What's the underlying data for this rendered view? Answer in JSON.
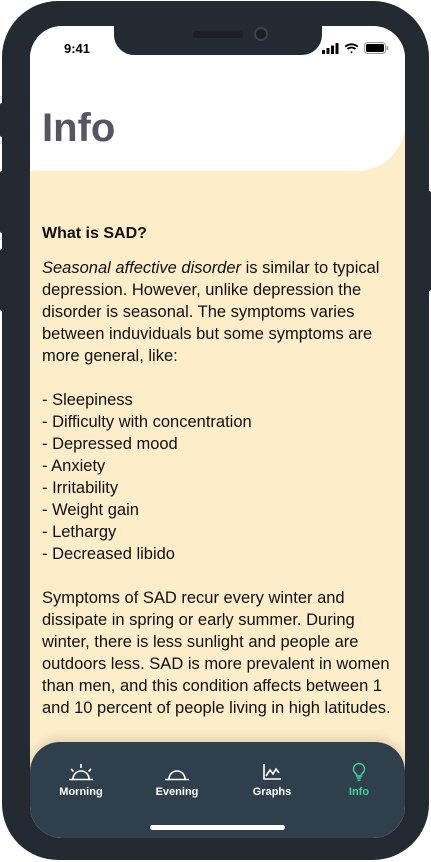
{
  "status_bar": {
    "time": "9:41",
    "icons": [
      "signal-icon",
      "wifi-icon",
      "battery-icon"
    ]
  },
  "page": {
    "title": "Info"
  },
  "article": {
    "heading": "What is SAD?",
    "intro_italic": "Seasonal affective disorder",
    "intro_rest": " is similar to typical depression. However, unlike depression the disorder is seasonal. The symptoms varies between induviduals but some symptoms are more general, like:",
    "symptoms": [
      "- Sleepiness",
      "- Difficulty with concentration",
      "- Depressed mood",
      "- Anxiety",
      "- Irritability",
      "- Weight gain",
      "- Lethargy",
      "- Decreased libido"
    ],
    "paragraph2": "Symptoms of SAD recur every winter and dissipate in spring or early summer. During winter, there is less sunlight and people are outdoors less. SAD is more prevalent in women than men, and this condition affects between 1 and 10 percent of people living in high latitudes."
  },
  "tabbar": {
    "tabs": [
      {
        "label": "Morning",
        "icon": "sunrise-icon",
        "active": false
      },
      {
        "label": "Evening",
        "icon": "sunset-icon",
        "active": false
      },
      {
        "label": "Graphs",
        "icon": "chart-icon",
        "active": false
      },
      {
        "label": "Info",
        "icon": "lightbulb-icon",
        "active": true
      }
    ]
  },
  "colors": {
    "background": "#fdedc9",
    "tabbar": "#2f3f4b",
    "active_tab": "#45d39a",
    "title": "#575563",
    "device_frame": "#232a31"
  }
}
